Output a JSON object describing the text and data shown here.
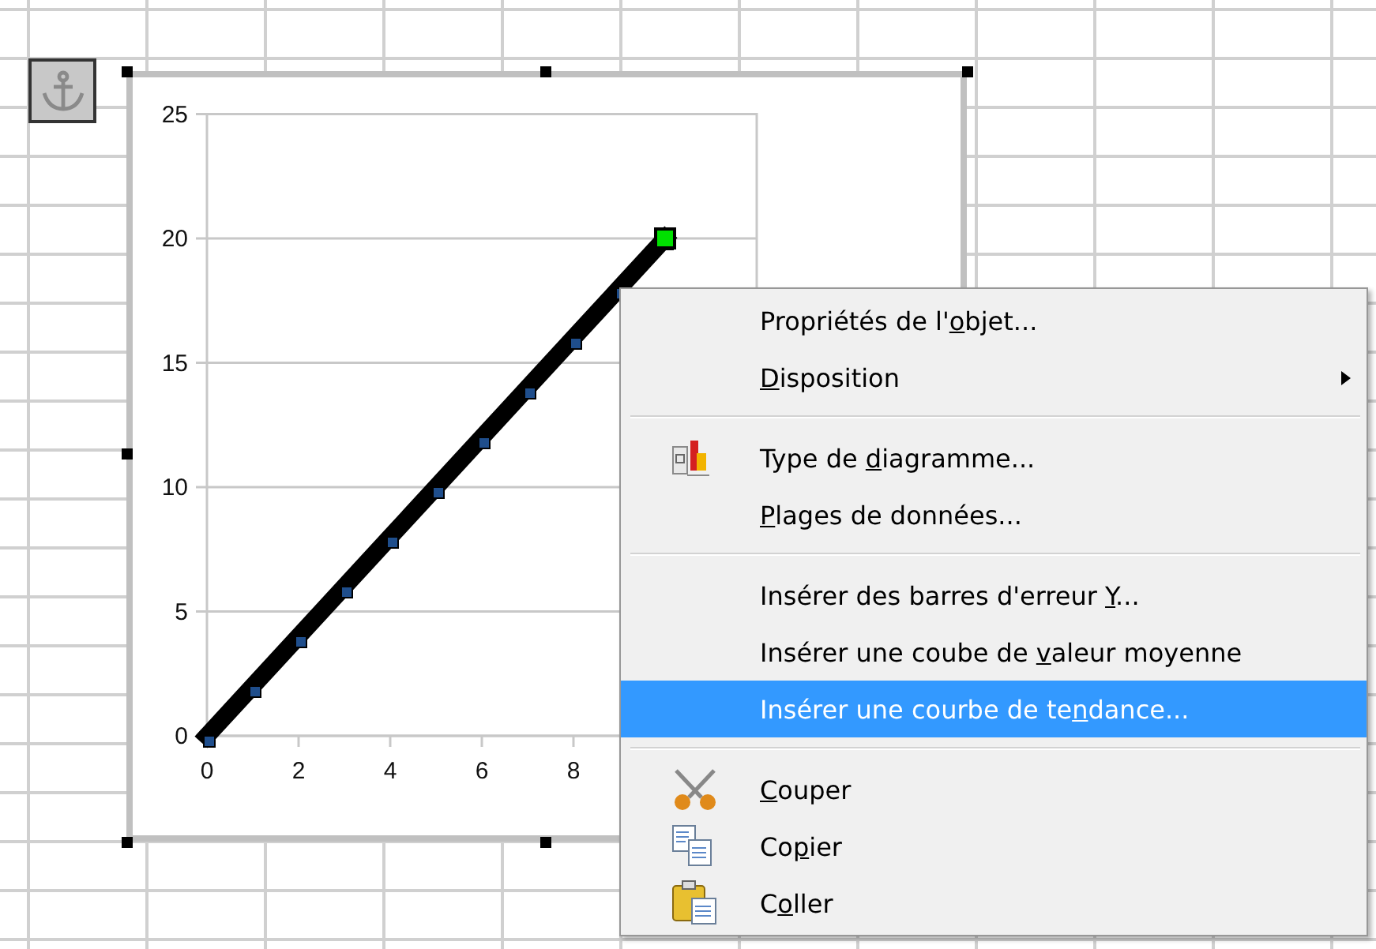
{
  "chart": {
    "chart_data": {
      "type": "line",
      "grid": true,
      "xlim": [
        0,
        12
      ],
      "ylim": [
        0,
        25
      ],
      "xticks": [
        0,
        2,
        4,
        6,
        8
      ],
      "yticks": [
        0,
        5,
        10,
        15,
        20,
        25
      ],
      "series": [
        {
          "color": "#000000",
          "x": [
            0,
            1,
            2,
            3,
            4,
            5,
            6,
            7,
            8,
            9,
            10
          ],
          "values": [
            0,
            2,
            4,
            6,
            8,
            10,
            12,
            14,
            16,
            18,
            20
          ]
        }
      ]
    }
  },
  "context_menu": {
    "items": [
      {
        "kind": "item",
        "before": "Propriétés de l'",
        "key": "o",
        "after": "bjet...",
        "selected": false
      },
      {
        "kind": "item",
        "key": "D",
        "after": "isposition",
        "submenu": true,
        "selected": false
      },
      {
        "kind": "separator"
      },
      {
        "kind": "item",
        "before": "Type de ",
        "key": "d",
        "after": "iagramme...",
        "selected": false
      },
      {
        "kind": "item",
        "key": "P",
        "after": "lages de données...",
        "selected": false
      },
      {
        "kind": "separator"
      },
      {
        "kind": "item",
        "before": "Insérer des barres d'erreur ",
        "key": "Y",
        "after": "...",
        "selected": false
      },
      {
        "kind": "item",
        "before": "Insérer une coube de ",
        "key": "v",
        "after": "aleur moyenne",
        "selected": false
      },
      {
        "kind": "item",
        "before": "Insérer une courbe de te",
        "key": "n",
        "after": "dance...",
        "selected": true
      },
      {
        "kind": "separator"
      },
      {
        "kind": "item",
        "key": "C",
        "after": "ouper",
        "selected": false
      },
      {
        "kind": "item",
        "before": "Co",
        "key": "p",
        "after": "ier",
        "selected": false
      },
      {
        "kind": "item",
        "before": "C",
        "key": "o",
        "after": "ller",
        "selected": false
      }
    ]
  }
}
